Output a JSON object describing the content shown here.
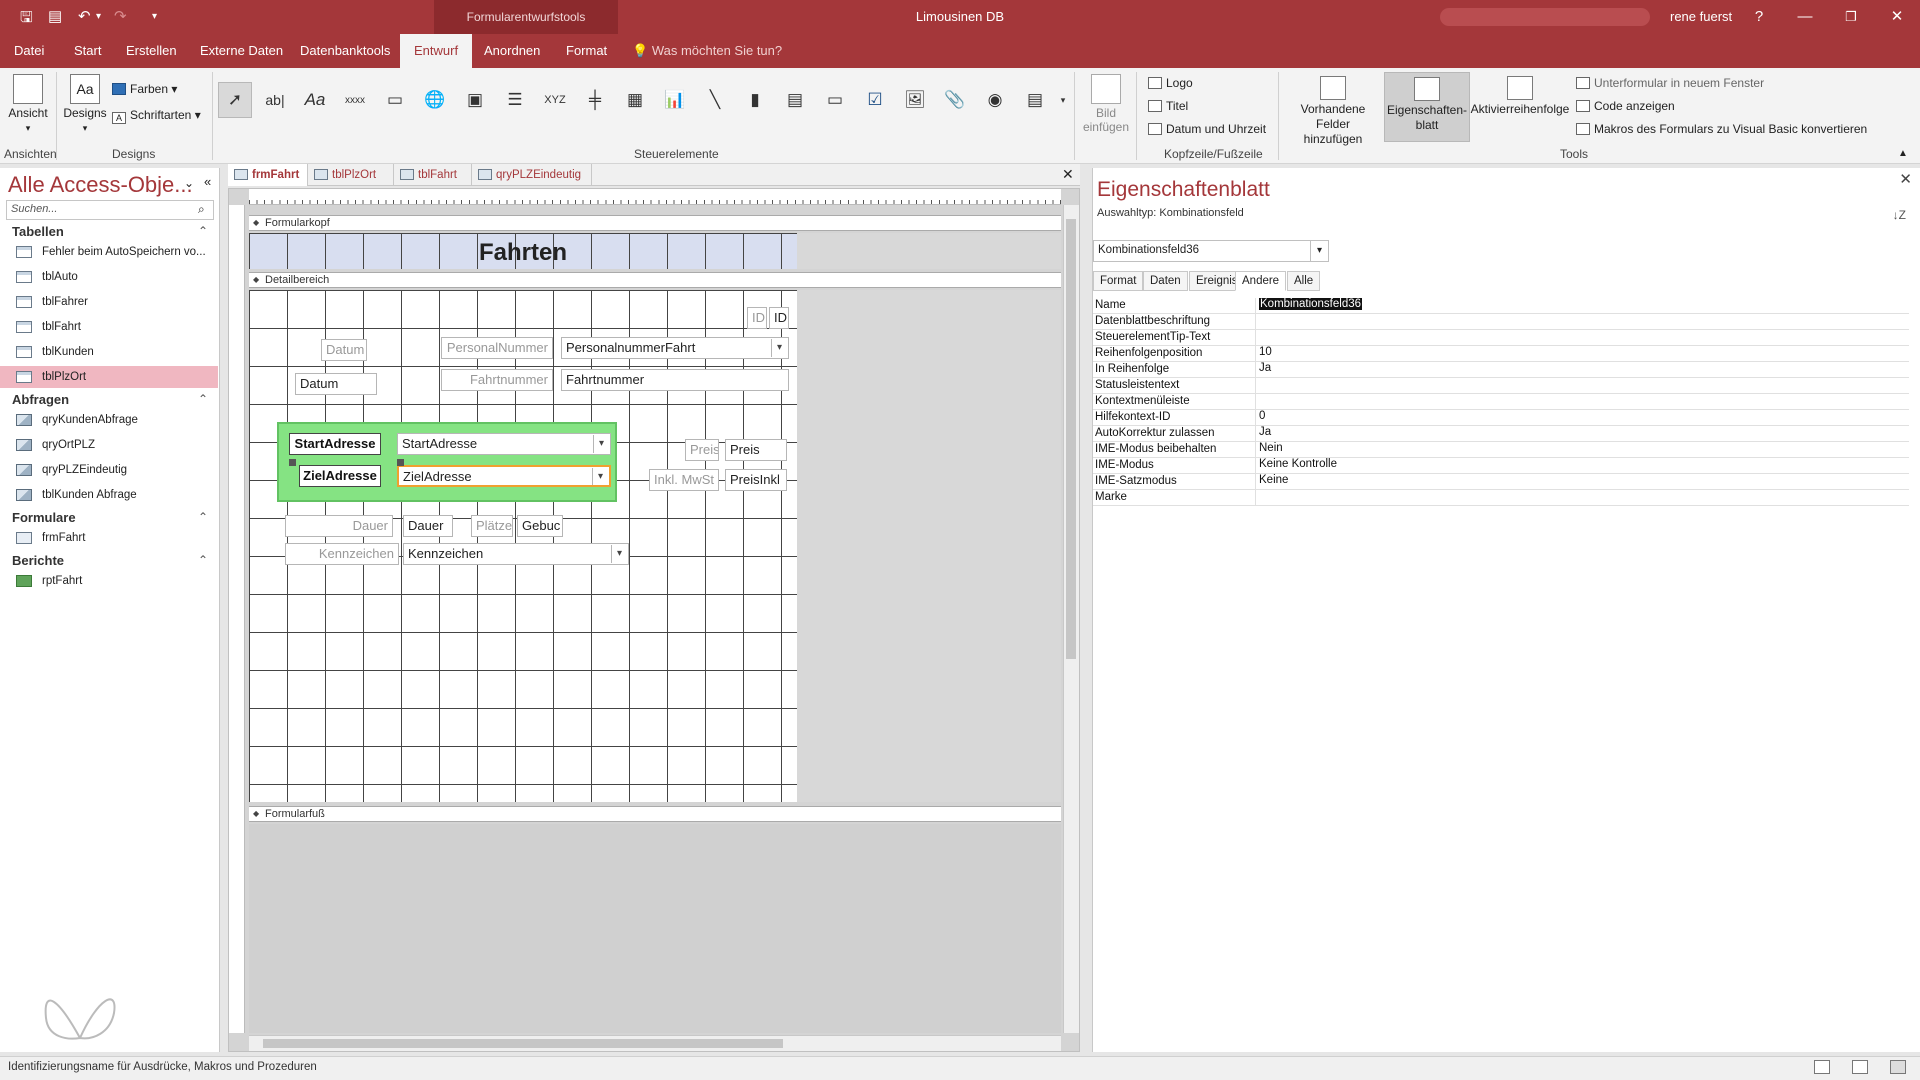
{
  "titlebar": {
    "context_tab": "Formularentwurfstools",
    "title": "Limousinen DB",
    "user": "rene fuerst",
    "help": "?",
    "minimize": "—",
    "restore": "❐",
    "close": "✕"
  },
  "tabs": {
    "items": [
      "Datei",
      "Start",
      "Erstellen",
      "Externe Daten",
      "Datenbanktools",
      "Entwurf",
      "Anordnen",
      "Format"
    ],
    "active": "Entwurf",
    "search_placeholder": "Was möchten Sie tun?"
  },
  "ribbon": {
    "ansicht_label": "Ansicht",
    "designs_label": "Designs",
    "farben_label": "Farben",
    "schriftarten_label": "Schriftarten",
    "group_ansichten": "Ansichten",
    "group_designs": "Designs",
    "group_steuerelemente": "Steuerelemente",
    "group_kopfzeile": "Kopfzeile/Fußzeile",
    "group_tools": "Tools",
    "bild_einfuegen": "Bild einfügen",
    "logo": "Logo",
    "titel": "Titel",
    "datum_uhrzeit": "Datum und Uhrzeit",
    "vorhandene_felder": "Vorhandene Felder hinzufügen",
    "eigenschaftenblatt": "Eigenschaften-blatt",
    "aktivierreihenfolge": "Aktivierreihenfolge",
    "unterformular": "Unterformular in neuem Fenster",
    "code_anzeigen": "Code anzeigen",
    "makros_konvertieren": "Makros des Formulars zu Visual Basic konvertieren",
    "text_ctl": "ab|",
    "label_ctl": "Aa",
    "xxxx_ctl": "xxxx",
    "xyz_ctl": "XYZ"
  },
  "nav": {
    "title": "Alle Access-Obje...",
    "search_placeholder": "Suchen...",
    "sections": [
      {
        "label": "Tabellen",
        "items": [
          "Fehler beim AutoSpeichern vo...",
          "tblAuto",
          "tblFahrer",
          "tblFahrt",
          "tblKunden",
          "tblPlzOrt"
        ]
      },
      {
        "label": "Abfragen",
        "items": [
          "qryKundenAbfrage",
          "qryOrtPLZ",
          "qryPLZEindeutig",
          "tblKunden Abfrage"
        ]
      },
      {
        "label": "Formulare",
        "items": [
          "frmFahrt"
        ]
      },
      {
        "label": "Berichte",
        "items": [
          "rptFahrt"
        ]
      }
    ],
    "selected": "tblPlzOrt"
  },
  "doctabs": [
    "frmFahrt",
    "tblPlzOrt",
    "tblFahrt",
    "qryPLZEindeutig"
  ],
  "design": {
    "formularkopf": "Formularkopf",
    "detailbereich": "Detailbereich",
    "formularfuss": "Formularfuß",
    "form_title": "Fahrten",
    "id_label": "ID",
    "id_field": "ID",
    "datum_label": "Datum",
    "datum_field": "Datum",
    "personalnummer_label": "PersonalNummer",
    "personalnummer_field": "PersonalnummerFahrt",
    "fahrtnummer_label": "Fahrtnummer",
    "fahrtnummer_field": "Fahrtnummer",
    "startadresse_label": "StartAdresse",
    "startadresse_field": "StartAdresse",
    "zieladresse_label": "ZielAdresse",
    "zieladresse_field": "ZielAdresse",
    "preis_label": "Preis",
    "preis_field": "Preis",
    "inkl_label": "Inkl. MwSt",
    "preisinkl_field": "PreisInkl",
    "dauer_label": "Dauer",
    "dauer_field": "Dauer",
    "plaetze_label": "Plätze",
    "gebucht_field": "Gebuc",
    "kennzeichen_label": "Kennzeichen",
    "kennzeichen_field": "Kennzeichen"
  },
  "propsheet": {
    "title": "Eigenschaftenblatt",
    "auswahltyp": "Auswahltyp:  Kombinationsfeld",
    "selected_control": "Kombinationsfeld36",
    "tabs": [
      "Format",
      "Daten",
      "Ereignis",
      "Andere",
      "Alle"
    ],
    "active_tab": "Andere",
    "rows": [
      {
        "name": "Name",
        "value": "Kombinationsfeld36"
      },
      {
        "name": "Datenblattbeschriftung",
        "value": ""
      },
      {
        "name": "SteuerelementTip-Text",
        "value": ""
      },
      {
        "name": "Reihenfolgenposition",
        "value": "10"
      },
      {
        "name": "In Reihenfolge",
        "value": "Ja"
      },
      {
        "name": "Statusleistentext",
        "value": ""
      },
      {
        "name": "Kontextmenüleiste",
        "value": ""
      },
      {
        "name": "Hilfekontext-ID",
        "value": "0"
      },
      {
        "name": "AutoKorrektur zulassen",
        "value": "Ja"
      },
      {
        "name": "IME-Modus beibehalten",
        "value": "Nein"
      },
      {
        "name": "IME-Modus",
        "value": "Keine Kontrolle"
      },
      {
        "name": "IME-Satzmodus",
        "value": "Keine"
      },
      {
        "name": "Marke",
        "value": ""
      }
    ]
  },
  "statusbar": {
    "text": "Identifizierungsname für Ausdrücke, Makros und Prozeduren"
  },
  "colors": {
    "accent": "#a4373a",
    "group_highlight": "#85e383",
    "nav_selected": "#f0b7c1"
  }
}
